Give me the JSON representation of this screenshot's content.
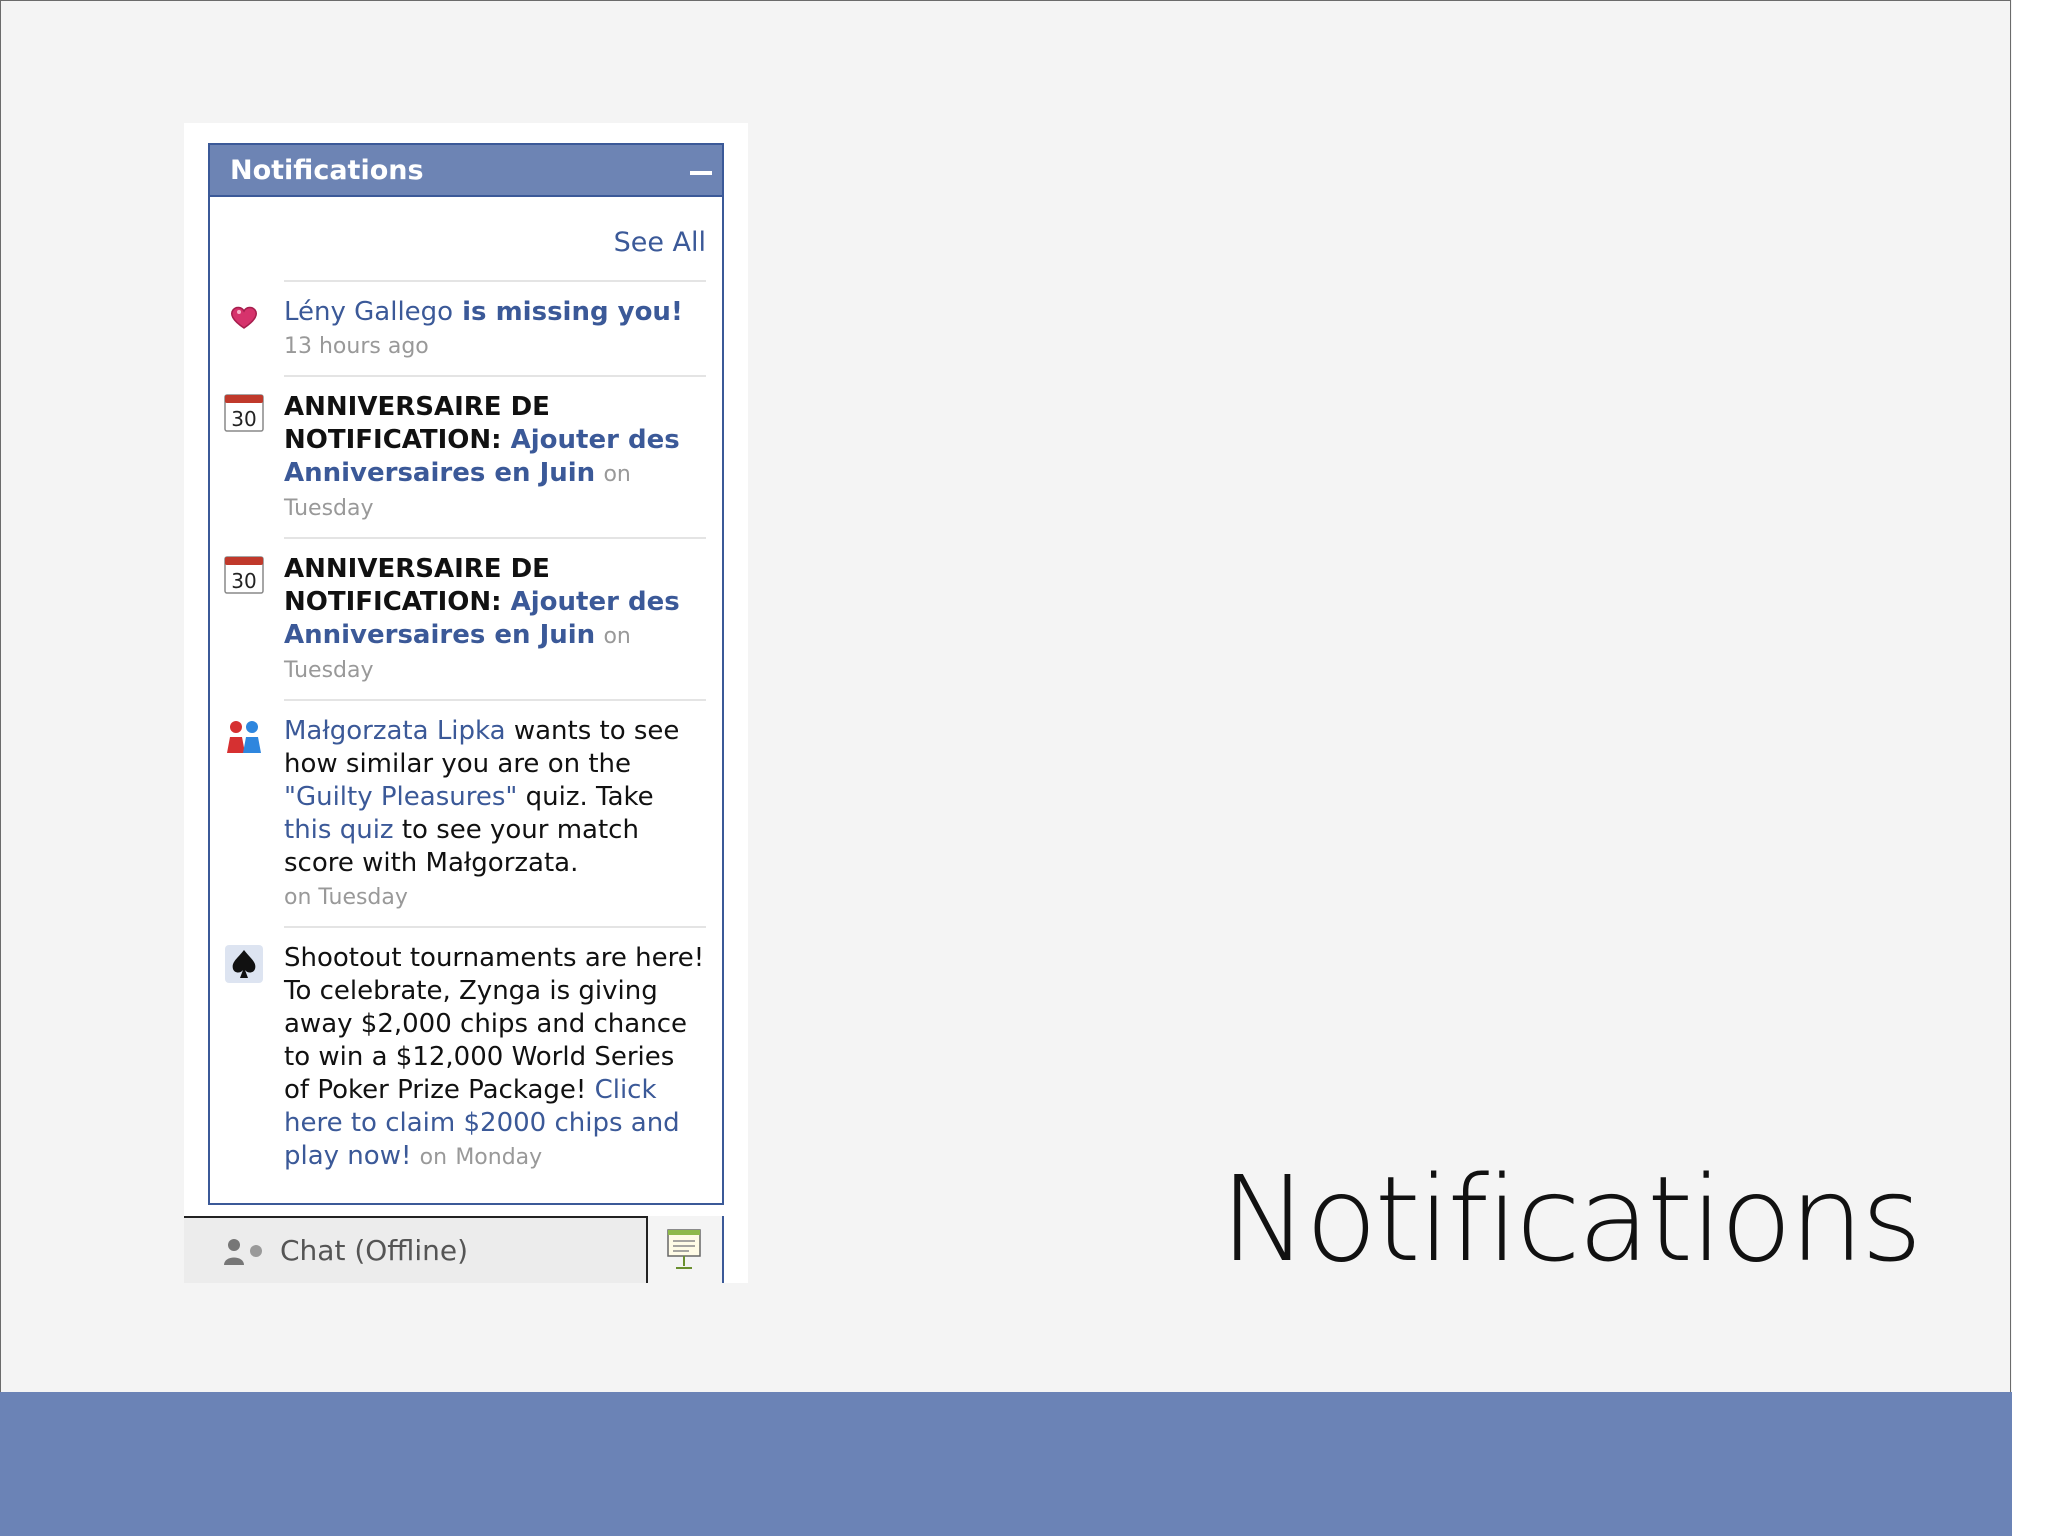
{
  "slide": {
    "title": "Notifications"
  },
  "panel": {
    "title": "Notifications",
    "see_all": "See All"
  },
  "notifications": [
    {
      "icon": "heart-icon",
      "name": "Lény Gallego",
      "text": " is missing you!",
      "time": "13 hours ago"
    },
    {
      "icon": "calendar-icon",
      "icon_text": "30",
      "heading": "ANNIVERSAIRE DE NOTIFICATION: ",
      "link": "Ajouter des Anniversaires en Juin",
      "time_prefix": "on",
      "time": "Tuesday"
    },
    {
      "icon": "calendar-icon",
      "icon_text": "30",
      "heading": "ANNIVERSAIRE DE NOTIFICATION: ",
      "link": "Ajouter des Anniversaires en Juin",
      "time_prefix": "on",
      "time": "Tuesday"
    },
    {
      "icon": "people-quiz-icon",
      "name": "Małgorzata Lipka",
      "text_1": " wants to see how similar you are on the ",
      "quiz": "\"Guilty Pleasures\"",
      "text_2": " quiz. Take ",
      "quiz_link": "this quiz",
      "text_3": " to see your match score with Małgorzata.",
      "time": "on Tuesday"
    },
    {
      "icon": "spade-icon",
      "text": "Shootout tournaments are here! To celebrate, Zynga is giving away $2,000 chips and chance to win a $12,000 World Series of Poker Prize Package! ",
      "link": "Click here to claim $2000 chips and play now!",
      "time_prefix": "on",
      "time": "Monday"
    }
  ],
  "chat": {
    "label": "Chat (Offline)"
  },
  "colors": {
    "brand": "#3b5998",
    "header": "#6d84b4",
    "footer_band": "#6b83b6"
  }
}
